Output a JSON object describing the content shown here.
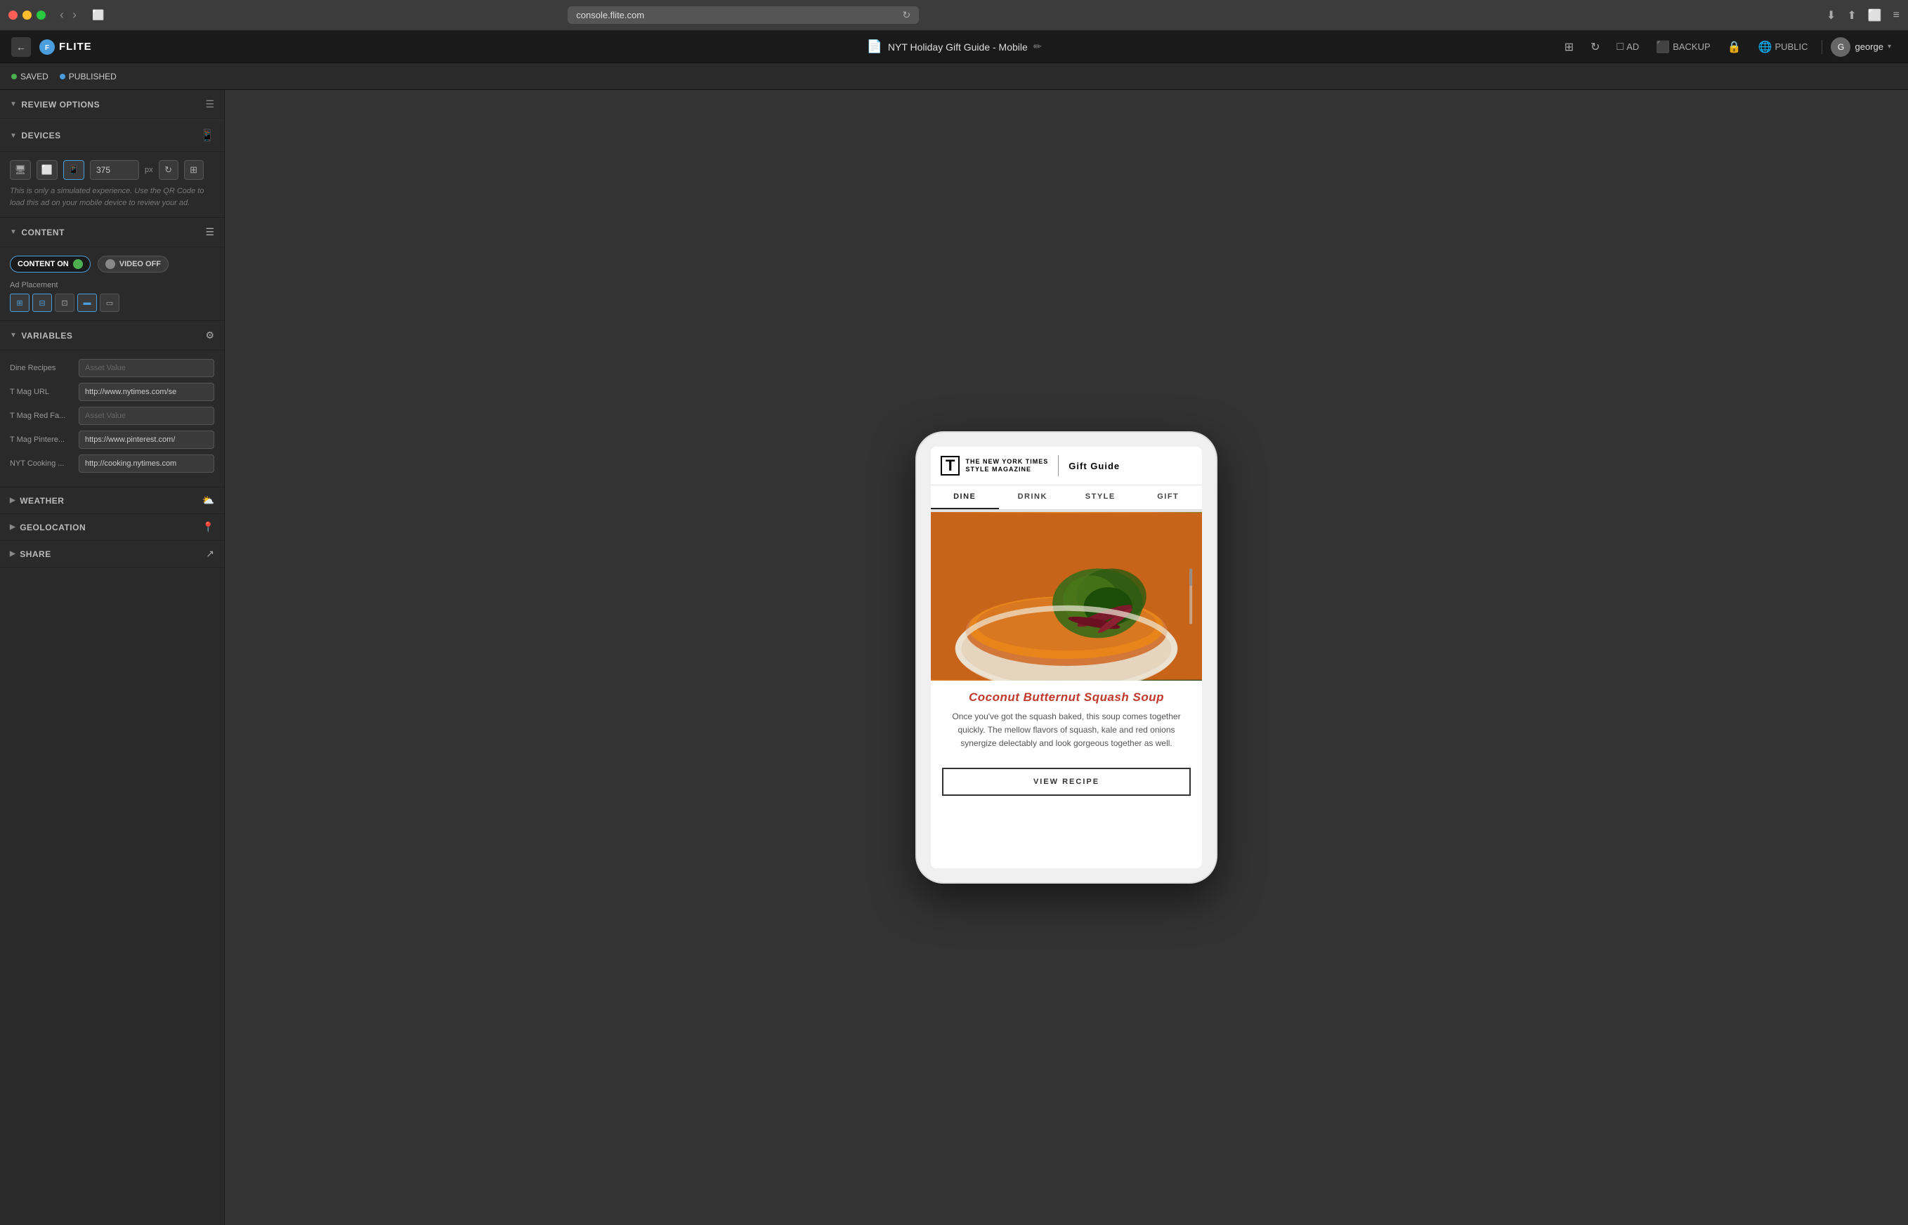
{
  "titlebar": {
    "url": "console.flite.com",
    "traffic_lights": [
      "red",
      "yellow",
      "green"
    ]
  },
  "appbar": {
    "logo": "FLITE",
    "doc_title": "NYT Holiday Gift Guide - Mobile",
    "user_name": "george"
  },
  "statusbar": {
    "saved_label": "SAVED",
    "published_label": "PUBLISHED",
    "ad_label": "AD",
    "backup_label": "BACKUP",
    "public_label": "PUBLIC"
  },
  "sidebar": {
    "review_options_title": "REVIEW OPTIONS",
    "devices_section": {
      "title": "DEVICES",
      "px_value": "375",
      "px_unit": "px",
      "simulated_text": "This is only a simulated experience. Use the QR Code to load this ad on your mobile device to review your ad."
    },
    "content_section": {
      "title": "CONTENT",
      "content_on_label": "CONTENT ON",
      "video_off_label": "VIDEO OFF",
      "ad_placement_label": "Ad Placement"
    },
    "variables_section": {
      "title": "VARIABLES",
      "fields": [
        {
          "label": "Dine Recipes",
          "placeholder": "Asset Value",
          "value": ""
        },
        {
          "label": "T Mag URL",
          "placeholder": "http://www.nytimes.com/se",
          "value": "http://www.nytimes.com/se"
        },
        {
          "label": "T Mag Red Fa...",
          "placeholder": "Asset Value",
          "value": ""
        },
        {
          "label": "T Mag Pintere...",
          "placeholder": "https://www.pinterest.com/",
          "value": "https://www.pinterest.com/"
        },
        {
          "label": "NYT Cooking ...",
          "placeholder": "http://cooking.nytimes.com",
          "value": "http://cooking.nytimes.com"
        }
      ]
    },
    "weather_section": {
      "title": "WEATHER"
    },
    "geolocation_section": {
      "title": "GEOLOCATION"
    },
    "share_section": {
      "title": "SHARE"
    }
  },
  "preview": {
    "nyt_brand": "THE NEW YORK TIMES STYLE MAGAZINE",
    "guide_label": "Gift Guide",
    "nav_items": [
      "DINE",
      "DRINK",
      "STYLE",
      "GIFT"
    ],
    "active_nav": "DINE",
    "recipe_title": "Coconut Butternut Squash Soup",
    "recipe_desc": "Once you've got the squash baked, this soup comes together quickly. The mellow flavors of squash, kale and red onions synergize delectably and look gorgeous together as well.",
    "view_recipe_btn": "VIEW RECIPE"
  }
}
